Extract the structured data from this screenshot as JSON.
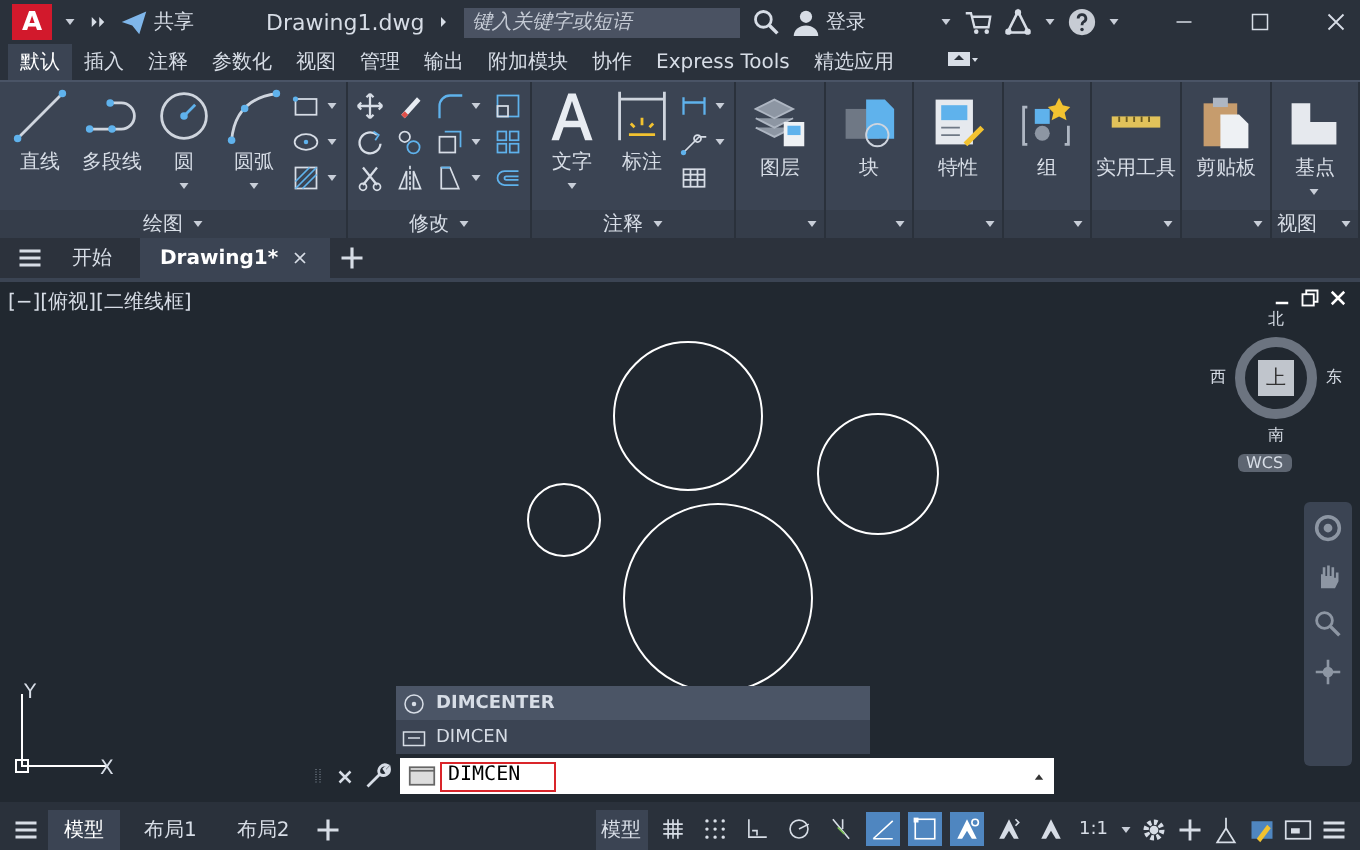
{
  "title_bar": {
    "app_letter": "A",
    "share": "共享",
    "file_name": "Drawing1.dwg",
    "search": {
      "placeholder": "键入关键字或短语"
    },
    "sign_in": "登录"
  },
  "ribbon_tabs": [
    {
      "label": "默认",
      "selected": true
    },
    {
      "label": "插入",
      "selected": false
    },
    {
      "label": "注释",
      "selected": false
    },
    {
      "label": "参数化",
      "selected": false
    },
    {
      "label": "视图",
      "selected": false
    },
    {
      "label": "管理",
      "selected": false
    },
    {
      "label": "输出",
      "selected": false
    },
    {
      "label": "附加模块",
      "selected": false
    },
    {
      "label": "协作",
      "selected": false
    },
    {
      "label": "Express Tools",
      "selected": false
    },
    {
      "label": "精选应用",
      "selected": false
    }
  ],
  "ribbon_panels": [
    {
      "kind": "draw",
      "title": "绘图",
      "buttons": [
        {
          "kind": "line",
          "label": "直线",
          "dropdown": false
        },
        {
          "kind": "polyline",
          "label": "多段线",
          "dropdown": false
        },
        {
          "kind": "circle",
          "label": "圆",
          "dropdown": true
        },
        {
          "kind": "arc",
          "label": "圆弧",
          "dropdown": true
        }
      ]
    },
    {
      "kind": "modify",
      "title": "修改"
    },
    {
      "kind": "annotate",
      "title": "注释",
      "buttons": [
        {
          "kind": "text",
          "label": "文字",
          "dropdown": true
        },
        {
          "kind": "dimension",
          "label": "标注",
          "dropdown": false
        }
      ]
    },
    {
      "kind": "single",
      "buttons": [
        {
          "kind": "layers",
          "label": "图层",
          "dropdown": false
        }
      ]
    },
    {
      "kind": "single",
      "buttons": [
        {
          "kind": "block",
          "label": "块",
          "dropdown": false
        }
      ]
    },
    {
      "kind": "single",
      "buttons": [
        {
          "kind": "properties",
          "label": "特性",
          "dropdown": false
        }
      ]
    },
    {
      "kind": "single",
      "buttons": [
        {
          "kind": "group",
          "label": "组",
          "dropdown": false
        }
      ]
    },
    {
      "kind": "single",
      "buttons": [
        {
          "kind": "ruler",
          "label": "实用工具",
          "dropdown": false
        }
      ]
    },
    {
      "kind": "single",
      "buttons": [
        {
          "kind": "clipboard",
          "label": "剪贴板",
          "dropdown": false
        }
      ]
    },
    {
      "kind": "single",
      "title": "视图",
      "buttons": [
        {
          "kind": "basepoint",
          "label": "基点",
          "dropdown": true
        }
      ]
    }
  ],
  "document_tabs": [
    {
      "label": "开始",
      "selected": false
    },
    {
      "label": "Drawing1*",
      "selected": true
    }
  ],
  "viewport": {
    "label": "[−][俯视][二维线框]"
  },
  "viewcube": {
    "north": "北",
    "south": "南",
    "west": "西",
    "east": "东",
    "top": "上",
    "coordinate_system": "WCS"
  },
  "ucs_icon": {
    "x_label": "X",
    "y_label": "Y"
  },
  "command_line": {
    "suggestions": [
      {
        "label": "DIMCENTER",
        "selected": true
      },
      {
        "label": "DIMCEN",
        "selected": false
      }
    ],
    "input": "DIMCEN"
  },
  "status_bar": {
    "layout_tabs": [
      {
        "label": "模型",
        "selected": true
      },
      {
        "label": "布局1",
        "selected": false
      },
      {
        "label": "布局2",
        "selected": false
      }
    ],
    "model_button": "模型",
    "toggles": [
      {
        "kind": "grid",
        "on": false
      },
      {
        "kind": "snap",
        "on": false
      },
      {
        "kind": "ortho",
        "on": false
      },
      {
        "kind": "polar",
        "on": false
      },
      {
        "kind": "osnap",
        "on": false
      },
      {
        "kind": "dynamic",
        "on": true
      },
      {
        "kind": "selection",
        "on": true
      },
      {
        "kind": "annotation",
        "on": true
      },
      {
        "kind": "autoscale",
        "on": false
      },
      {
        "kind": "annoscale",
        "on": false
      }
    ],
    "scale": "1:1"
  }
}
